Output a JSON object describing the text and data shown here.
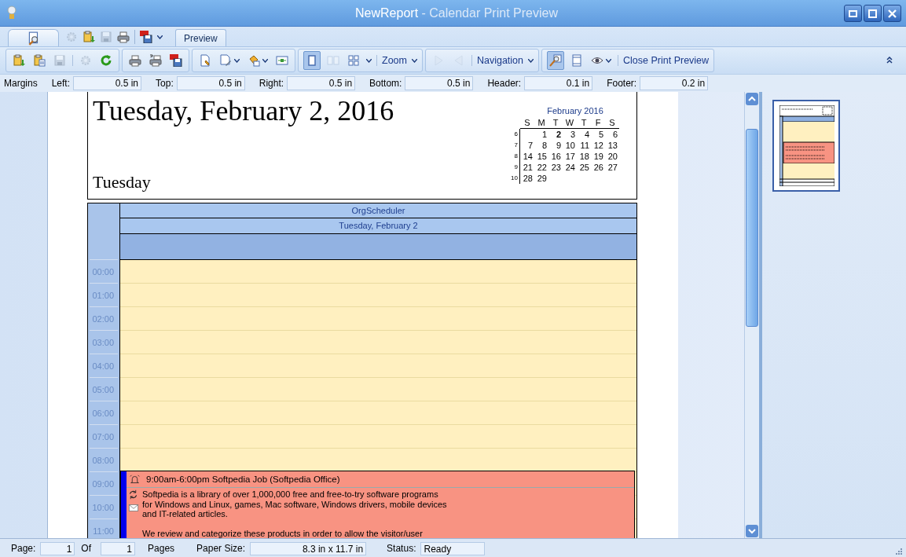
{
  "window": {
    "title_document": "NewReport",
    "title_app": "- Calendar Print Preview"
  },
  "quick_access": [
    {
      "kind": "icon",
      "disabled": true
    },
    {
      "kind": "icon",
      "disabled": false
    },
    {
      "kind": "icon",
      "disabled": true
    },
    {
      "kind": "icon",
      "disabled": false
    },
    {
      "kind": "separator"
    },
    {
      "kind": "icon",
      "disabled": false
    },
    {
      "kind": "caret"
    }
  ],
  "ribbon": {
    "tabs": [
      {
        "label": "Preview",
        "selected": true
      }
    ]
  },
  "toolbar": {
    "groups": [
      {
        "items": [
          {
            "kind": "icon",
            "disabled": false
          },
          {
            "kind": "icon",
            "disabled": false
          },
          {
            "kind": "icon",
            "disabled": true
          },
          {
            "kind": "separator"
          },
          {
            "kind": "icon",
            "disabled": true
          },
          {
            "kind": "icon",
            "disabled": false
          }
        ]
      },
      {
        "items": [
          {
            "kind": "icon",
            "disabled": false
          },
          {
            "kind": "icon",
            "disabled": false
          },
          {
            "kind": "icon",
            "disabled": false
          }
        ]
      },
      {
        "items": [
          {
            "kind": "icon",
            "disabled": false
          },
          {
            "kind": "icon",
            "disabled": false,
            "dropdown": true
          },
          {
            "kind": "icon",
            "disabled": false,
            "dropdown": true
          },
          {
            "kind": "icon",
            "disabled": false
          }
        ]
      },
      {
        "items": [
          {
            "kind": "icon",
            "disabled": false,
            "selected": true
          },
          {
            "kind": "icon",
            "disabled": true,
            "selected": false
          },
          {
            "kind": "icon",
            "disabled": false,
            "selected": false
          },
          {
            "kind": "caret"
          },
          {
            "kind": "separator"
          },
          {
            "kind": "menu",
            "label": "Zoom"
          }
        ]
      },
      {
        "items": [
          {
            "kind": "icon",
            "disabled": true
          },
          {
            "kind": "icon",
            "disabled": true
          },
          {
            "kind": "separator"
          },
          {
            "kind": "menu",
            "label": "Navigation"
          }
        ]
      },
      {
        "items": [
          {
            "kind": "icon",
            "disabled": false,
            "selected": true
          },
          {
            "kind": "icon",
            "disabled": false,
            "selected": false
          },
          {
            "kind": "icon",
            "disabled": false,
            "dropdown": true
          },
          {
            "kind": "separator"
          },
          {
            "kind": "button",
            "label": "Close Print Preview"
          }
        ]
      }
    ]
  },
  "margins": {
    "label": "Margins",
    "fields": [
      {
        "label": "Left:",
        "value": "0.5 in"
      },
      {
        "label": "Top:",
        "value": "0.5 in"
      },
      {
        "label": "Right:",
        "value": "0.5 in"
      },
      {
        "label": "Bottom:",
        "value": "0.5 in"
      },
      {
        "label": "Header:",
        "value": "0.1 in"
      },
      {
        "label": "Footer:",
        "value": "0.2 in"
      }
    ]
  },
  "page": {
    "date_title": "Tuesday, February 2, 2016",
    "day_name": "Tuesday",
    "mini_calendar": {
      "title": "February 2016",
      "weekdays": [
        "S",
        "M",
        "T",
        "W",
        "T",
        "F",
        "S"
      ],
      "weeks": [
        {
          "number": "6",
          "days": [
            {
              "d": "1",
              "bold": false
            },
            {
              "d": "2",
              "bold": true
            },
            {
              "d": "3",
              "bold": false
            },
            {
              "d": "4",
              "bold": false
            },
            {
              "d": "5",
              "bold": false
            },
            {
              "d": "6",
              "bold": false
            }
          ]
        },
        {
          "number": "7",
          "days": [
            {
              "d": "7",
              "bold": false
            },
            {
              "d": "8",
              "bold": false
            },
            {
              "d": "9",
              "bold": false
            },
            {
              "d": "10",
              "bold": false
            },
            {
              "d": "11",
              "bold": false
            },
            {
              "d": "12",
              "bold": false
            },
            {
              "d": "13",
              "bold": false
            }
          ]
        },
        {
          "number": "8",
          "days": [
            {
              "d": "14",
              "bold": false
            },
            {
              "d": "15",
              "bold": false
            },
            {
              "d": "16",
              "bold": false
            },
            {
              "d": "17",
              "bold": false
            },
            {
              "d": "18",
              "bold": false
            },
            {
              "d": "19",
              "bold": false
            },
            {
              "d": "20",
              "bold": false
            }
          ]
        },
        {
          "number": "9",
          "days": [
            {
              "d": "21",
              "bold": false
            },
            {
              "d": "22",
              "bold": false
            },
            {
              "d": "23",
              "bold": false
            },
            {
              "d": "24",
              "bold": false
            },
            {
              "d": "25",
              "bold": false
            },
            {
              "d": "26",
              "bold": false
            },
            {
              "d": "27",
              "bold": false
            }
          ]
        },
        {
          "number": "10",
          "days": [
            {
              "d": "28",
              "bold": false
            },
            {
              "d": "29",
              "bold": false
            }
          ]
        }
      ]
    },
    "scheduler": {
      "resource": "OrgScheduler",
      "date_header": "Tuesday, February 2",
      "slots": [
        {
          "time": "00:00"
        },
        {
          "time": "01:00"
        },
        {
          "time": "02:00"
        },
        {
          "time": "03:00"
        },
        {
          "time": "04:00"
        },
        {
          "time": "05:00"
        },
        {
          "time": "06:00"
        },
        {
          "time": "07:00"
        },
        {
          "time": "08:00"
        },
        {
          "time": "09:00",
          "appointment": {
            "title": "9:00am-6:00pm Softpedia Job (Softpedia Office)",
            "description": [
              "Softpedia is a library of over 1,000,000 free and free-to-try software programs",
              "for Windows and Linux, games, Mac software, Windows drivers, mobile devices",
              "and IT-related articles."
            ],
            "description_2": "We review and categorize these products in order to allow the visitor/user"
          }
        },
        {
          "time": "10:00"
        },
        {
          "time": "11:00"
        }
      ]
    }
  },
  "status_bar": {
    "page_label": "Page:",
    "page": "1",
    "of_label": "Of",
    "pages": "1",
    "pages_label": "Pages",
    "paper_label": "Paper Size:",
    "paper_size": "8.3 in x 11.7 in",
    "status_label": "Status:",
    "status": "Ready"
  }
}
